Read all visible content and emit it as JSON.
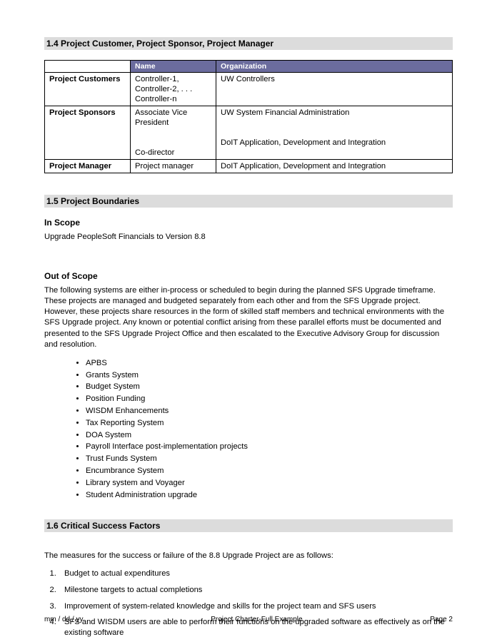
{
  "sections": {
    "s14": {
      "heading": "1.4 Project Customer, Project Sponsor, Project Manager",
      "table": {
        "headers": [
          "",
          "Name",
          "Organization"
        ],
        "rows": [
          {
            "role": "Project Customers",
            "name": "Controller-1, Controller-2,  .  .  . Controller-n",
            "org": "UW Controllers"
          },
          {
            "role": "Project Sponsors",
            "name": "Associate Vice President\n\nCo-director",
            "org": "UW System Financial Administration\n\nDoIT Application, Development and Integration"
          },
          {
            "role": "Project Manager",
            "name": "Project manager",
            "org": "DoIT Application, Development and Integration"
          }
        ]
      }
    },
    "s15": {
      "heading": "1.5  Project Boundaries",
      "inScope": {
        "title": "In Scope",
        "text": "Upgrade PeopleSoft Financials to Version 8.8"
      },
      "outOfScope": {
        "title": "Out of Scope",
        "text": "The following systems are either in-process or scheduled to begin during the planned SFS Upgrade timeframe. These projects are managed and budgeted separately from each other and from the SFS Upgrade project. However, these projects share resources in the form of skilled staff members and technical environments with the SFS Upgrade project. Any known or potential conflict arising from these parallel efforts must be documented and presented to the SFS Upgrade Project Office and then escalated to the Executive Advisory Group for discussion and resolution.",
        "items": [
          "APBS",
          "Grants System",
          "Budget System",
          "Position Funding",
          "WISDM Enhancements",
          "Tax Reporting System",
          "DOA System",
          "Payroll Interface post-implementation projects",
          "Trust Funds System",
          "Encumbrance System",
          "Library system and Voyager",
          "Student Administration upgrade"
        ]
      }
    },
    "s16": {
      "heading": "1.6  Critical Success Factors",
      "intro": "The measures for the success or failure of the 8.8 Upgrade Project are as follows:",
      "items": [
        "Budget to actual expenditures",
        "Milestone targets to actual completions",
        "Improvement of system-related knowledge and skills for the project team and SFS users",
        "SFS and WISDM users are able to perform their functions on the upgraded software as effectively as on the existing software"
      ]
    }
  },
  "footer": {
    "date": "mm / dd / yy",
    "title": "Project Charter-Full Example",
    "page": "Page 2"
  }
}
